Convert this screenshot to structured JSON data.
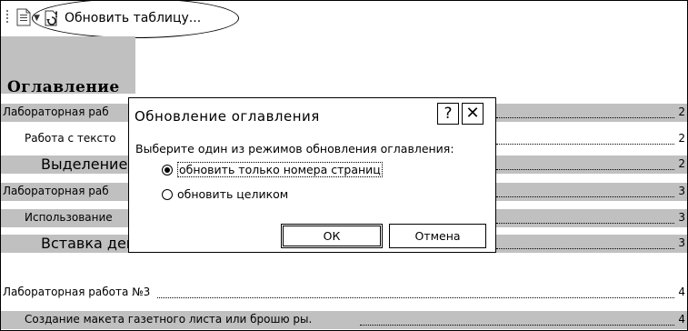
{
  "toolbar": {
    "update_table_label": "Обновить таблицу..."
  },
  "toc": {
    "title": "Оглавление",
    "rows": [
      {
        "text": "Лабораторная раб",
        "page": "2"
      },
      {
        "text": "Работа с тексто",
        "page": "2"
      },
      {
        "text": "Выделение",
        "page": "2"
      },
      {
        "text": "Лабораторная раб",
        "page": "3"
      },
      {
        "text": "Использование",
        "page": "3"
      },
      {
        "text": "Вставка деко",
        "page": "3"
      },
      {
        "text": "Лабораторная работа №3",
        "page": "4"
      },
      {
        "text": "Создание макета газетного листа или брошю ры.",
        "page": "4"
      }
    ]
  },
  "dialog": {
    "title": "Обновление оглавления",
    "help_label": "?",
    "close_label": "✕",
    "prompt": "Выберите один из режимов обновления оглавления:",
    "options": [
      {
        "label": "обновить только номера страниц",
        "selected": true
      },
      {
        "label": "обновить целиком",
        "selected": false
      }
    ],
    "ok_label": "ОК",
    "cancel_label": "Отмена"
  }
}
